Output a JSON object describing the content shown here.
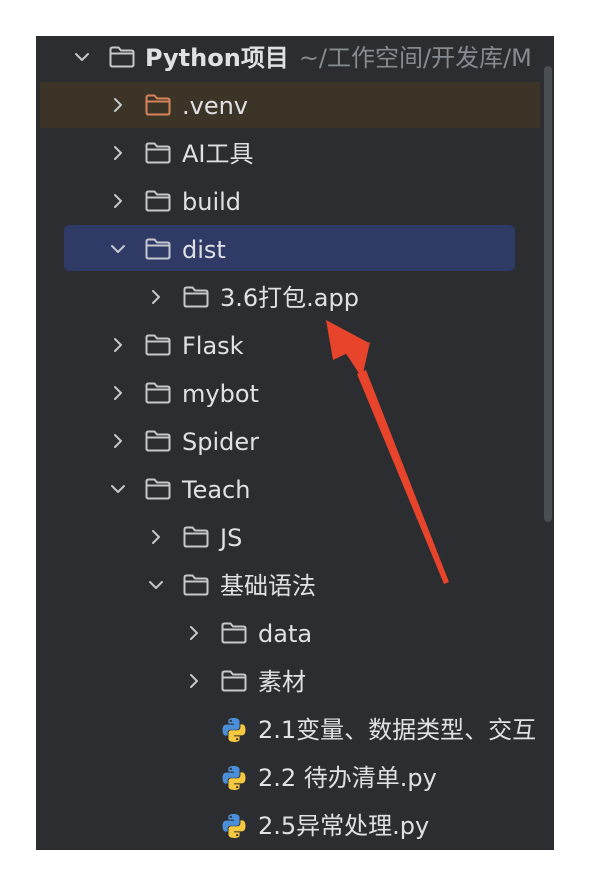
{
  "tree": {
    "root": {
      "name": "Python项目",
      "path": "~/工作空间/开发库/M"
    },
    "items": [
      {
        "label": ".venv"
      },
      {
        "label": "AI工具"
      },
      {
        "label": "build"
      },
      {
        "label": "dist"
      },
      {
        "label": "3.6打包.app"
      },
      {
        "label": "Flask"
      },
      {
        "label": "mybot"
      },
      {
        "label": "Spider"
      },
      {
        "label": "Teach"
      },
      {
        "label": "JS"
      },
      {
        "label": "基础语法"
      },
      {
        "label": "data"
      },
      {
        "label": "素材"
      },
      {
        "label": "2.1变量、数据类型、交互"
      },
      {
        "label": "2.2 待办清单.py"
      },
      {
        "label": "2.5异常处理.py"
      }
    ]
  },
  "colors": {
    "panel_bg": "#2b2d30",
    "selected_bg": "#2f3a66",
    "venv_bg": "#3d3428",
    "venv_folder": "#d6835b",
    "text": "#dfe1e5",
    "path_text": "#868a91",
    "annotation_arrow": "#e8442c"
  },
  "icons": {
    "folder": "folder-icon",
    "python_file": "python-file-icon",
    "chevron_right": "chevron-right-icon",
    "chevron_down": "chevron-down-icon"
  }
}
